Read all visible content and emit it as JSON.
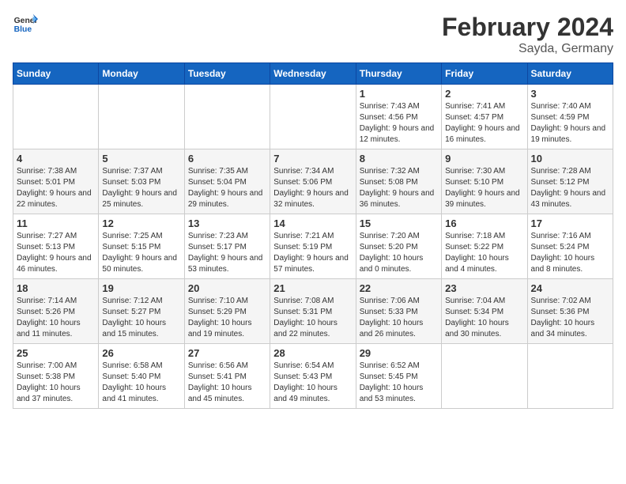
{
  "header": {
    "logo_general": "General",
    "logo_blue": "Blue",
    "title": "February 2024",
    "subtitle": "Sayda, Germany"
  },
  "calendar": {
    "weekdays": [
      "Sunday",
      "Monday",
      "Tuesday",
      "Wednesday",
      "Thursday",
      "Friday",
      "Saturday"
    ],
    "weeks": [
      [
        {
          "day": "",
          "info": ""
        },
        {
          "day": "",
          "info": ""
        },
        {
          "day": "",
          "info": ""
        },
        {
          "day": "",
          "info": ""
        },
        {
          "day": "1",
          "info": "Sunrise: 7:43 AM\nSunset: 4:56 PM\nDaylight: 9 hours and 12 minutes."
        },
        {
          "day": "2",
          "info": "Sunrise: 7:41 AM\nSunset: 4:57 PM\nDaylight: 9 hours and 16 minutes."
        },
        {
          "day": "3",
          "info": "Sunrise: 7:40 AM\nSunset: 4:59 PM\nDaylight: 9 hours and 19 minutes."
        }
      ],
      [
        {
          "day": "4",
          "info": "Sunrise: 7:38 AM\nSunset: 5:01 PM\nDaylight: 9 hours and 22 minutes."
        },
        {
          "day": "5",
          "info": "Sunrise: 7:37 AM\nSunset: 5:03 PM\nDaylight: 9 hours and 25 minutes."
        },
        {
          "day": "6",
          "info": "Sunrise: 7:35 AM\nSunset: 5:04 PM\nDaylight: 9 hours and 29 minutes."
        },
        {
          "day": "7",
          "info": "Sunrise: 7:34 AM\nSunset: 5:06 PM\nDaylight: 9 hours and 32 minutes."
        },
        {
          "day": "8",
          "info": "Sunrise: 7:32 AM\nSunset: 5:08 PM\nDaylight: 9 hours and 36 minutes."
        },
        {
          "day": "9",
          "info": "Sunrise: 7:30 AM\nSunset: 5:10 PM\nDaylight: 9 hours and 39 minutes."
        },
        {
          "day": "10",
          "info": "Sunrise: 7:28 AM\nSunset: 5:12 PM\nDaylight: 9 hours and 43 minutes."
        }
      ],
      [
        {
          "day": "11",
          "info": "Sunrise: 7:27 AM\nSunset: 5:13 PM\nDaylight: 9 hours and 46 minutes."
        },
        {
          "day": "12",
          "info": "Sunrise: 7:25 AM\nSunset: 5:15 PM\nDaylight: 9 hours and 50 minutes."
        },
        {
          "day": "13",
          "info": "Sunrise: 7:23 AM\nSunset: 5:17 PM\nDaylight: 9 hours and 53 minutes."
        },
        {
          "day": "14",
          "info": "Sunrise: 7:21 AM\nSunset: 5:19 PM\nDaylight: 9 hours and 57 minutes."
        },
        {
          "day": "15",
          "info": "Sunrise: 7:20 AM\nSunset: 5:20 PM\nDaylight: 10 hours and 0 minutes."
        },
        {
          "day": "16",
          "info": "Sunrise: 7:18 AM\nSunset: 5:22 PM\nDaylight: 10 hours and 4 minutes."
        },
        {
          "day": "17",
          "info": "Sunrise: 7:16 AM\nSunset: 5:24 PM\nDaylight: 10 hours and 8 minutes."
        }
      ],
      [
        {
          "day": "18",
          "info": "Sunrise: 7:14 AM\nSunset: 5:26 PM\nDaylight: 10 hours and 11 minutes."
        },
        {
          "day": "19",
          "info": "Sunrise: 7:12 AM\nSunset: 5:27 PM\nDaylight: 10 hours and 15 minutes."
        },
        {
          "day": "20",
          "info": "Sunrise: 7:10 AM\nSunset: 5:29 PM\nDaylight: 10 hours and 19 minutes."
        },
        {
          "day": "21",
          "info": "Sunrise: 7:08 AM\nSunset: 5:31 PM\nDaylight: 10 hours and 22 minutes."
        },
        {
          "day": "22",
          "info": "Sunrise: 7:06 AM\nSunset: 5:33 PM\nDaylight: 10 hours and 26 minutes."
        },
        {
          "day": "23",
          "info": "Sunrise: 7:04 AM\nSunset: 5:34 PM\nDaylight: 10 hours and 30 minutes."
        },
        {
          "day": "24",
          "info": "Sunrise: 7:02 AM\nSunset: 5:36 PM\nDaylight: 10 hours and 34 minutes."
        }
      ],
      [
        {
          "day": "25",
          "info": "Sunrise: 7:00 AM\nSunset: 5:38 PM\nDaylight: 10 hours and 37 minutes."
        },
        {
          "day": "26",
          "info": "Sunrise: 6:58 AM\nSunset: 5:40 PM\nDaylight: 10 hours and 41 minutes."
        },
        {
          "day": "27",
          "info": "Sunrise: 6:56 AM\nSunset: 5:41 PM\nDaylight: 10 hours and 45 minutes."
        },
        {
          "day": "28",
          "info": "Sunrise: 6:54 AM\nSunset: 5:43 PM\nDaylight: 10 hours and 49 minutes."
        },
        {
          "day": "29",
          "info": "Sunrise: 6:52 AM\nSunset: 5:45 PM\nDaylight: 10 hours and 53 minutes."
        },
        {
          "day": "",
          "info": ""
        },
        {
          "day": "",
          "info": ""
        }
      ]
    ]
  }
}
